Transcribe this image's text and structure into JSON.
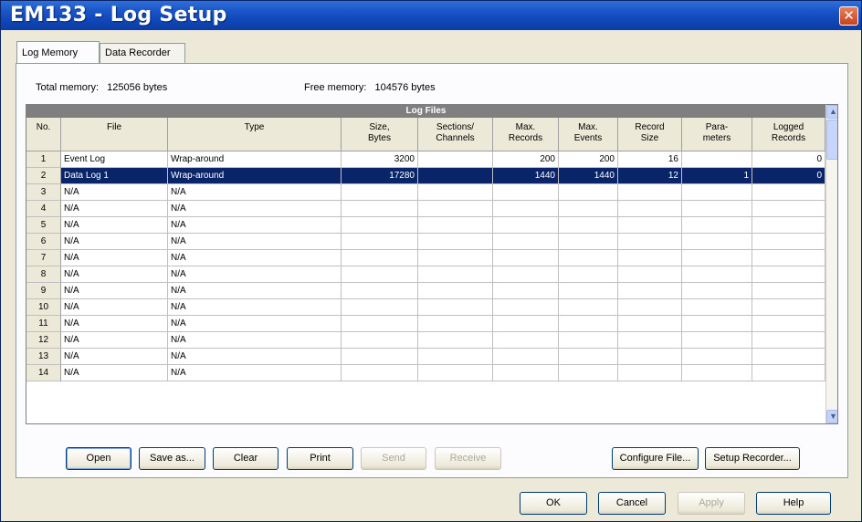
{
  "window": {
    "title": "EM133 - Log Setup",
    "close_label": "✕"
  },
  "tabs": [
    {
      "label": "Log Memory",
      "active": true
    },
    {
      "label": "Data Recorder",
      "active": false
    }
  ],
  "memory": {
    "total_label": "Total memory:",
    "total_value": "125056 bytes",
    "free_label": "Free memory:",
    "free_value": "104576 bytes"
  },
  "table": {
    "banner": "Log Files",
    "columns": [
      "No.",
      "File",
      "Type",
      "Size,\nBytes",
      "Sections/\nChannels",
      "Max.\nRecords",
      "Max.\nEvents",
      "Record\nSize",
      "Para-\nmeters",
      "Logged\nRecords"
    ],
    "rows": [
      [
        "1",
        "Event Log",
        "Wrap-around",
        "3200",
        "",
        "200",
        "200",
        "16",
        "",
        "0"
      ],
      [
        "2",
        "Data Log 1",
        "Wrap-around",
        "17280",
        "",
        "1440",
        "1440",
        "12",
        "1",
        "0"
      ],
      [
        "3",
        "N/A",
        "N/A",
        "",
        "",
        "",
        "",
        "",
        "",
        ""
      ],
      [
        "4",
        "N/A",
        "N/A",
        "",
        "",
        "",
        "",
        "",
        "",
        ""
      ],
      [
        "5",
        "N/A",
        "N/A",
        "",
        "",
        "",
        "",
        "",
        "",
        ""
      ],
      [
        "6",
        "N/A",
        "N/A",
        "",
        "",
        "",
        "",
        "",
        "",
        ""
      ],
      [
        "7",
        "N/A",
        "N/A",
        "",
        "",
        "",
        "",
        "",
        "",
        ""
      ],
      [
        "8",
        "N/A",
        "N/A",
        "",
        "",
        "",
        "",
        "",
        "",
        ""
      ],
      [
        "9",
        "N/A",
        "N/A",
        "",
        "",
        "",
        "",
        "",
        "",
        ""
      ],
      [
        "10",
        "N/A",
        "N/A",
        "",
        "",
        "",
        "",
        "",
        "",
        ""
      ],
      [
        "11",
        "N/A",
        "N/A",
        "",
        "",
        "",
        "",
        "",
        "",
        ""
      ],
      [
        "12",
        "N/A",
        "N/A",
        "",
        "",
        "",
        "",
        "",
        "",
        ""
      ],
      [
        "13",
        "N/A",
        "N/A",
        "",
        "",
        "",
        "",
        "",
        "",
        ""
      ],
      [
        "14",
        "N/A",
        "N/A",
        "",
        "",
        "",
        "",
        "",
        "",
        ""
      ]
    ],
    "selected_row": 1
  },
  "scrollbar": {
    "up_icon": "▲",
    "down_icon": "▼"
  },
  "buttons": {
    "open": "Open",
    "save_as": "Save as...",
    "clear": "Clear",
    "print": "Print",
    "send": "Send",
    "receive": "Receive",
    "configure_file": "Configure File...",
    "setup_recorder": "Setup Recorder..."
  },
  "dialog_buttons": {
    "ok": "OK",
    "cancel": "Cancel",
    "apply": "Apply",
    "help": "Help"
  }
}
